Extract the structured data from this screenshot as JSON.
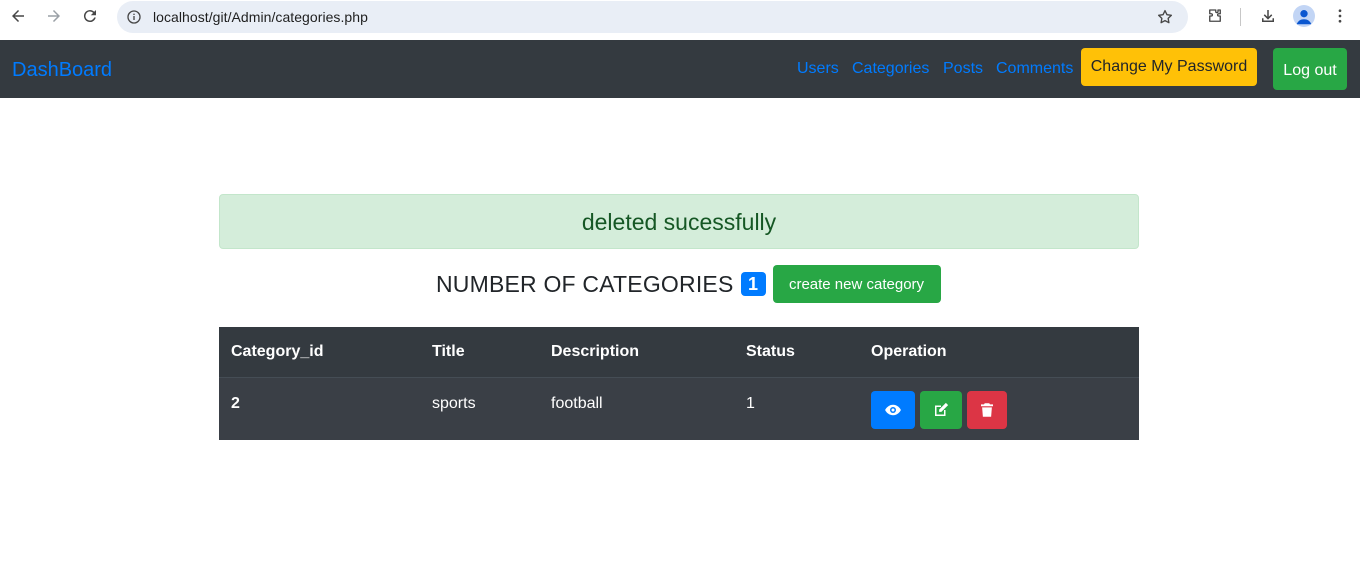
{
  "browser": {
    "url": "localhost/git/Admin/categories.php"
  },
  "navbar": {
    "brand": "DashBoard",
    "links": [
      "Users",
      "Categories",
      "Posts",
      "Comments"
    ],
    "change_password_label": "Change My Password",
    "logout_label": "Log out"
  },
  "alert": {
    "message": "deleted sucessfully"
  },
  "summary": {
    "title": "NUMBER OF CATEGORIES",
    "count": "1",
    "create_label": "create new category"
  },
  "table": {
    "columns": [
      "Category_id",
      "Title",
      "Description",
      "Status",
      "Operation"
    ],
    "rows": [
      {
        "id": "2",
        "title": "sports",
        "description": "football",
        "status": "1"
      }
    ]
  },
  "icons": {
    "view": "eye-icon",
    "edit": "edit-icon",
    "delete": "trash-icon"
  },
  "colors": {
    "primary": "#007bff",
    "success": "#28a745",
    "danger": "#dc3545",
    "warning": "#ffc107",
    "dark": "#343a40"
  }
}
